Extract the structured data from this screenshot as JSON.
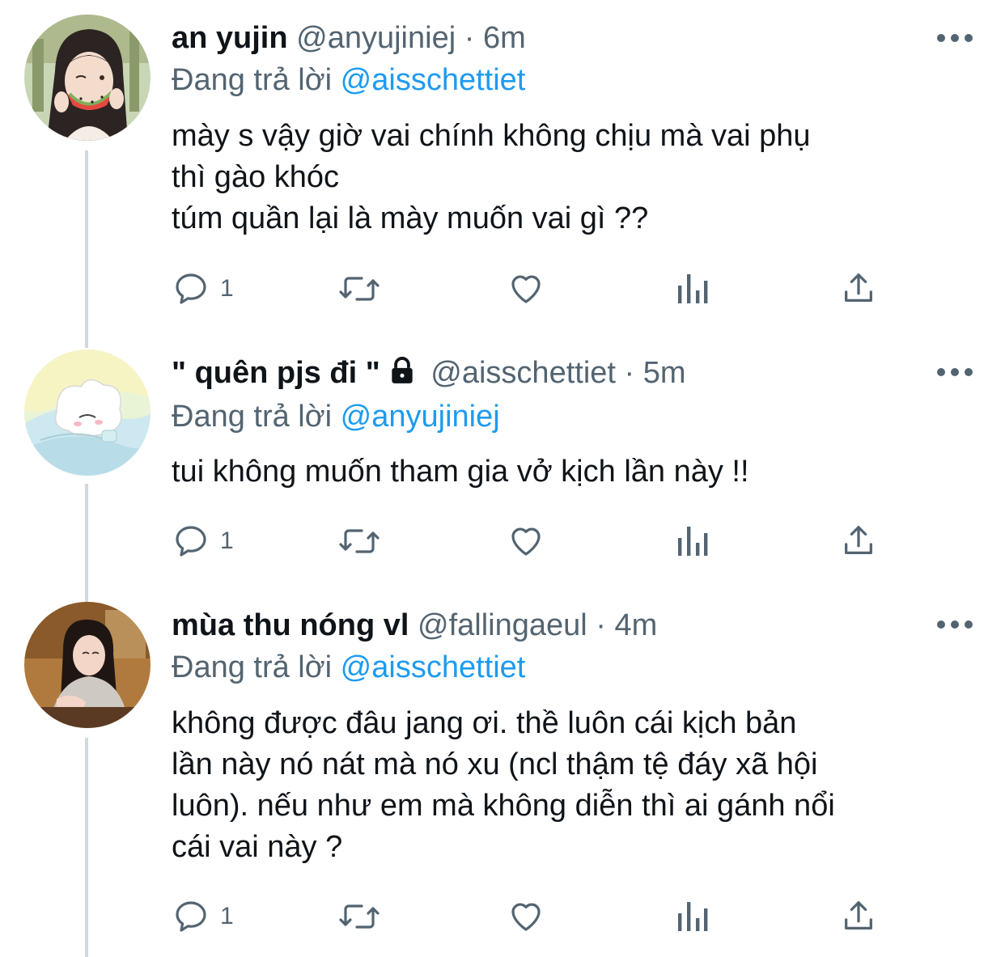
{
  "colors": {
    "link": "#1d9bf0",
    "secondary": "#536471",
    "text": "#0f1419",
    "thread_line": "#cfd9de"
  },
  "tweets": [
    {
      "name": "an yujin",
      "handle": "@anyujiniej",
      "dot": "·",
      "time": "6m",
      "locked": false,
      "reply_prefix": "Đang trả lời",
      "reply_to": "@aisschettiet",
      "text": "mày s vậy giờ vai chính không chịu mà vai phụ\nthì gào khóc\ntúm quần lại là mày muốn vai gì ??",
      "reply_count": "1",
      "icons": {
        "avatar": "avatar-photo",
        "reply": "reply-icon",
        "retweet": "retweet-icon",
        "like": "heart-icon",
        "views": "analytics-icon",
        "share": "share-icon"
      }
    },
    {
      "name": "\" quên pjs đi \"",
      "handle": "@aisschettiet",
      "dot": "·",
      "time": "5m",
      "locked": true,
      "reply_prefix": "Đang trả lời",
      "reply_to": "@anyujiniej",
      "text": "tui không muốn tham gia vở kịch lần này !!",
      "reply_count": "1",
      "icons": {
        "avatar": "avatar-illustration",
        "lock": "lock-icon"
      }
    },
    {
      "name": "mùa thu nóng vl",
      "handle": "@fallingaeul",
      "dot": "·",
      "time": "4m",
      "locked": false,
      "reply_prefix": "Đang trả lời",
      "reply_to": "@aisschettiet",
      "text": "không được đâu jang ơi. thề luôn cái kịch bản\nlần này nó nát mà nó xu (ncl thậm tệ đáy xã hội\nluôn). nếu như em mà không diễn thì ai gánh nổi\ncái vai này ?",
      "reply_count": "1",
      "icons": {
        "avatar": "avatar-photo"
      }
    }
  ]
}
